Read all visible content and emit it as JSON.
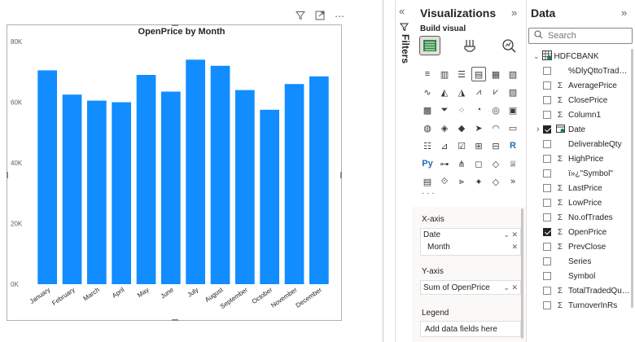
{
  "visual_header": {
    "filter_icon": "filter-icon",
    "focus_icon": "focus-mode-icon",
    "more_icon": "more-options-icon",
    "more_label": "⋯"
  },
  "chart_data": {
    "type": "bar",
    "title": "OpenPrice by Month",
    "categories": [
      "January",
      "February",
      "March",
      "April",
      "May",
      "June",
      "July",
      "August",
      "September",
      "October",
      "November",
      "December"
    ],
    "values": [
      70500,
      62500,
      60500,
      60000,
      69000,
      63500,
      74000,
      72000,
      64000,
      57500,
      66000,
      68500
    ],
    "ylim": [
      0,
      80000
    ],
    "yticks": [
      {
        "value": 0,
        "label": "0K"
      },
      {
        "value": 20000,
        "label": "20K"
      },
      {
        "value": 40000,
        "label": "40K"
      },
      {
        "value": 60000,
        "label": "60K"
      },
      {
        "value": 80000,
        "label": "80K"
      }
    ],
    "xlabel": "",
    "ylabel": "",
    "grid": false,
    "bar_color": "#118dff"
  },
  "filters": {
    "label": "Filters",
    "expand_glyph": "«",
    "filter_icon": "filter-pane-icon"
  },
  "visualizations": {
    "title": "Visualizations",
    "collapse_glyph": "»",
    "build_visual_label": "Build visual",
    "more_label": "· · ·",
    "viz_icons": [
      {
        "name": "stacked-bar-icon",
        "glyph": "≡"
      },
      {
        "name": "stacked-column-icon",
        "glyph": "▥"
      },
      {
        "name": "clustered-bar-icon",
        "glyph": "☰"
      },
      {
        "name": "clustered-column-icon",
        "glyph": "▤",
        "selected": true
      },
      {
        "name": "100-stacked-bar-icon",
        "glyph": "▦"
      },
      {
        "name": "100-stacked-column-icon",
        "glyph": "▧"
      },
      {
        "name": "line-chart-icon",
        "glyph": "∿"
      },
      {
        "name": "area-chart-icon",
        "glyph": "◭"
      },
      {
        "name": "stacked-area-icon",
        "glyph": "◮"
      },
      {
        "name": "line-stacked-column-icon",
        "glyph": "⩘"
      },
      {
        "name": "line-clustered-column-icon",
        "glyph": "⩗"
      },
      {
        "name": "ribbon-chart-icon",
        "glyph": "▨"
      },
      {
        "name": "waterfall-icon",
        "glyph": "▩"
      },
      {
        "name": "funnel-icon",
        "glyph": "⏷"
      },
      {
        "name": "scatter-icon",
        "glyph": "⁘"
      },
      {
        "name": "pie-icon",
        "glyph": "◔"
      },
      {
        "name": "donut-icon",
        "glyph": "◎"
      },
      {
        "name": "treemap-icon",
        "glyph": "▣"
      },
      {
        "name": "map-icon",
        "glyph": "◍"
      },
      {
        "name": "filled-map-icon",
        "glyph": "◈"
      },
      {
        "name": "azure-map-icon",
        "glyph": "◆"
      },
      {
        "name": "navigation-icon",
        "glyph": "➤"
      },
      {
        "name": "gauge-icon",
        "glyph": "◠"
      },
      {
        "name": "card-icon",
        "glyph": "▭"
      },
      {
        "name": "multi-row-card-icon",
        "glyph": "☷"
      },
      {
        "name": "kpi-icon",
        "glyph": "⊿"
      },
      {
        "name": "slicer-icon",
        "glyph": "☑"
      },
      {
        "name": "table-icon",
        "glyph": "⊞"
      },
      {
        "name": "matrix-icon",
        "glyph": "⊟"
      },
      {
        "name": "r-visual-icon",
        "glyph": "R"
      },
      {
        "name": "python-visual-icon",
        "glyph": "Py"
      },
      {
        "name": "key-influencers-icon",
        "glyph": "⊶"
      },
      {
        "name": "decomposition-tree-icon",
        "glyph": "⋔"
      },
      {
        "name": "qa-icon",
        "glyph": "◻"
      },
      {
        "name": "smart-narrative-icon",
        "glyph": "◇"
      },
      {
        "name": "trophy-icon",
        "glyph": "♕"
      },
      {
        "name": "paginated-report-icon",
        "glyph": "▤"
      },
      {
        "name": "power-apps-icon",
        "glyph": "⟐"
      },
      {
        "name": "power-automate-icon",
        "glyph": "⫸"
      },
      {
        "name": "custom-visual-icon",
        "glyph": "✦"
      },
      {
        "name": "diamond-visual-icon",
        "glyph": "◇"
      },
      {
        "name": "chevron-visual-icon",
        "glyph": "»"
      }
    ],
    "wells": {
      "x_axis": {
        "label": "X-axis",
        "field": "Date",
        "subfield": "Month"
      },
      "y_axis": {
        "label": "Y-axis",
        "field": "Sum of OpenPrice"
      },
      "legend": {
        "label": "Legend",
        "placeholder": "Add data fields here"
      }
    }
  },
  "data_pane": {
    "title": "Data",
    "collapse_glyph": "»",
    "search_placeholder": "Search",
    "table_name": "HDFCBANK",
    "fields": [
      {
        "name": "%DlyQttoTraded...",
        "sigma": false,
        "checked": false
      },
      {
        "name": "AveragePrice",
        "sigma": true,
        "checked": false
      },
      {
        "name": "ClosePrice",
        "sigma": true,
        "checked": false
      },
      {
        "name": "Column1",
        "sigma": true,
        "checked": false
      },
      {
        "name": "Date",
        "sigma": false,
        "checked": true,
        "expandable": true,
        "calendar": true
      },
      {
        "name": "DeliverableQty",
        "sigma": false,
        "checked": false
      },
      {
        "name": "HighPrice",
        "sigma": true,
        "checked": false
      },
      {
        "name": "ï»¿\"Symbol\"",
        "sigma": false,
        "checked": false
      },
      {
        "name": "LastPrice",
        "sigma": true,
        "checked": false
      },
      {
        "name": "LowPrice",
        "sigma": true,
        "checked": false
      },
      {
        "name": "No.ofTrades",
        "sigma": true,
        "checked": false
      },
      {
        "name": "OpenPrice",
        "sigma": true,
        "checked": true
      },
      {
        "name": "PrevClose",
        "sigma": true,
        "checked": false
      },
      {
        "name": "Series",
        "sigma": false,
        "checked": false
      },
      {
        "name": "Symbol",
        "sigma": false,
        "checked": false
      },
      {
        "name": "TotalTradedQua...",
        "sigma": true,
        "checked": false
      },
      {
        "name": "TurnoverInRs",
        "sigma": true,
        "checked": false
      }
    ]
  }
}
